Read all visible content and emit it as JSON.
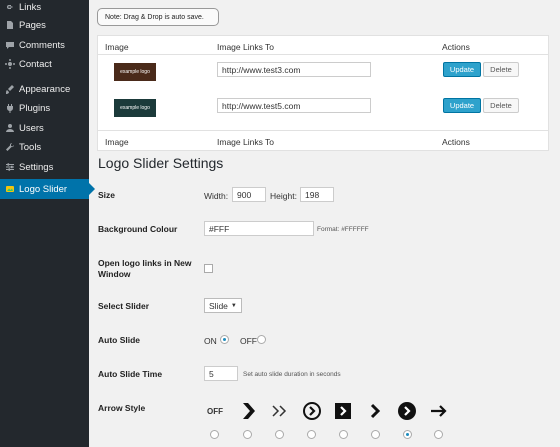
{
  "sidebar": {
    "items": [
      {
        "label": "Links",
        "icon": "links-icon"
      },
      {
        "label": "Pages",
        "icon": "pages-icon"
      },
      {
        "label": "Comments",
        "icon": "comments-icon"
      },
      {
        "label": "Contact",
        "icon": "contact-icon"
      },
      {
        "label": "Appearance",
        "icon": "appearance-icon"
      },
      {
        "label": "Plugins",
        "icon": "plugins-icon"
      },
      {
        "label": "Users",
        "icon": "users-icon"
      },
      {
        "label": "Tools",
        "icon": "tools-icon"
      },
      {
        "label": "Settings",
        "icon": "settings-icon"
      },
      {
        "label": "Logo Slider",
        "icon": "logo-slider-icon",
        "active": true
      }
    ]
  },
  "note": "Note: Drag & Drop is auto save.",
  "table": {
    "headers": [
      "Image",
      "Image Links To",
      "Actions"
    ],
    "rows": [
      {
        "logo_text": "example logo",
        "logo_color": "#4a2a1a",
        "link": "http://www.test3.com"
      },
      {
        "logo_text": "example logo",
        "logo_color": "#1b3a3a",
        "link": "http://www.test5.com"
      }
    ],
    "update_label": "Update",
    "delete_label": "Delete"
  },
  "settings": {
    "title": "Logo Slider Settings",
    "size": {
      "label": "Size",
      "width_label": "Width:",
      "width_value": "900",
      "height_label": "Height:",
      "height_value": "198"
    },
    "background": {
      "label": "Background Colour",
      "value": "#FFF",
      "hint": "Format: #FFFFFF"
    },
    "new_window": {
      "label": "Open logo links in New Window"
    },
    "select_slider": {
      "label": "Select Slider",
      "value": "Slide"
    },
    "auto_slide": {
      "label": "Auto Slide",
      "on_label": "ON",
      "off_label": "OFF",
      "selected": "ON"
    },
    "auto_slide_time": {
      "label": "Auto Slide Time",
      "value": "5",
      "hint": "Set auto slide duration in seconds"
    },
    "arrow_style": {
      "label": "Arrow Style",
      "off_label": "OFF",
      "options": [
        "off",
        "bold-chevron",
        "double-chevron",
        "circle-chevron",
        "square-chevron",
        "chevron",
        "filled-circle-chevron",
        "arrow"
      ],
      "selected_index": 6
    }
  },
  "colors": {
    "sidebar_bg": "#23282d",
    "accent": "#0073aa",
    "button_blue": "#2ea2cc"
  }
}
